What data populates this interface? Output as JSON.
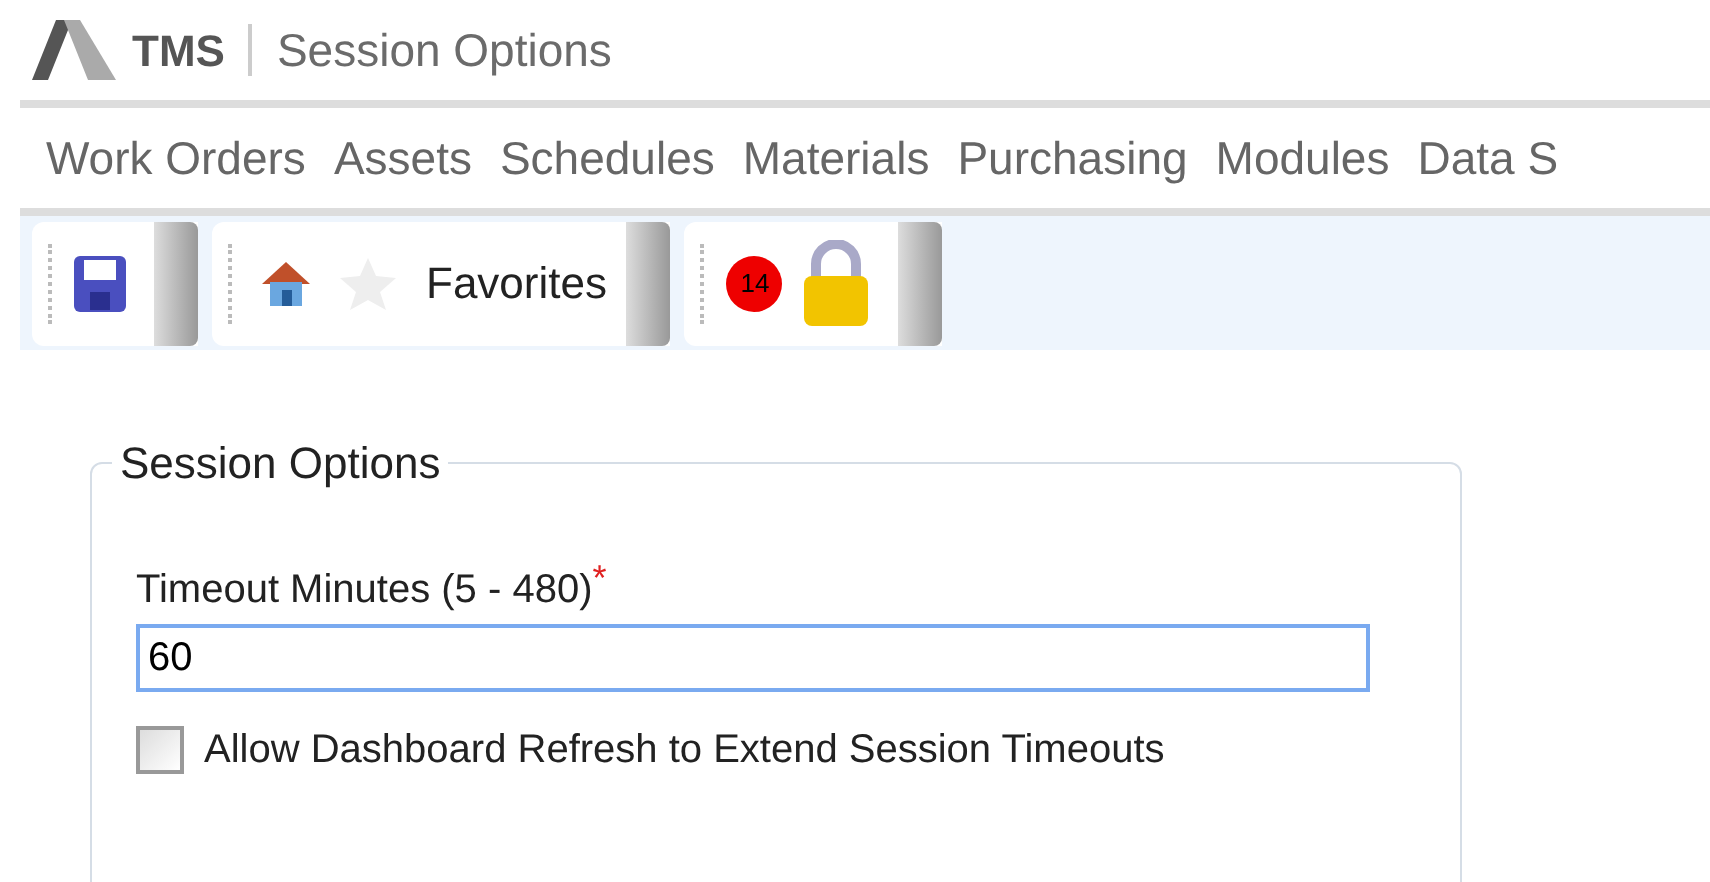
{
  "header": {
    "brand": "TMS",
    "title": "Session Options"
  },
  "menu": [
    {
      "label": "Work Orders"
    },
    {
      "label": "Assets"
    },
    {
      "label": "Schedules"
    },
    {
      "label": "Materials"
    },
    {
      "label": "Purchasing"
    },
    {
      "label": "Modules"
    },
    {
      "label": "Data S"
    }
  ],
  "toolbar": {
    "favorites_label": "Favorites",
    "alert_count": "14"
  },
  "panel": {
    "legend": "Session Options",
    "timeout_label": "Timeout Minutes (5 - 480)",
    "required_mark": "*",
    "timeout_value": "60",
    "refresh_option": {
      "label": "Allow Dashboard Refresh to Extend Session Timeouts",
      "checked": false
    }
  }
}
